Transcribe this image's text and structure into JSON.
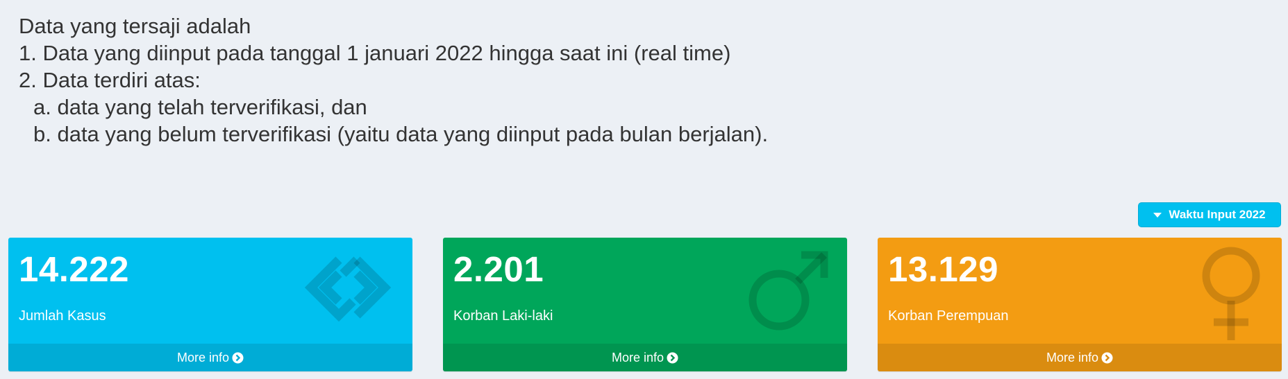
{
  "intro": {
    "lines": [
      "Data yang tersaji adalah",
      "1. Data yang diinput pada tanggal 1 januari 2022 hingga saat ini (real time)",
      "2. Data terdiri atas:",
      "a. data yang telah terverifikasi, dan",
      "b. data yang belum terverifikasi (yaitu data yang diinput pada bulan berjalan)."
    ]
  },
  "filter": {
    "label": "Waktu Input 2022",
    "color": "#00c0ef"
  },
  "boxes": [
    {
      "value": "14.222",
      "label": "Jumlah Kasus",
      "footer": "More info",
      "icon": "chain-link-icon",
      "color": "#00c0ef"
    },
    {
      "value": "2.201",
      "label": "Korban Laki-laki",
      "footer": "More info",
      "icon": "male-icon",
      "color": "#00a65a"
    },
    {
      "value": "13.129",
      "label": "Korban Perempuan",
      "footer": "More info",
      "icon": "female-icon",
      "color": "#f39c12"
    }
  ]
}
